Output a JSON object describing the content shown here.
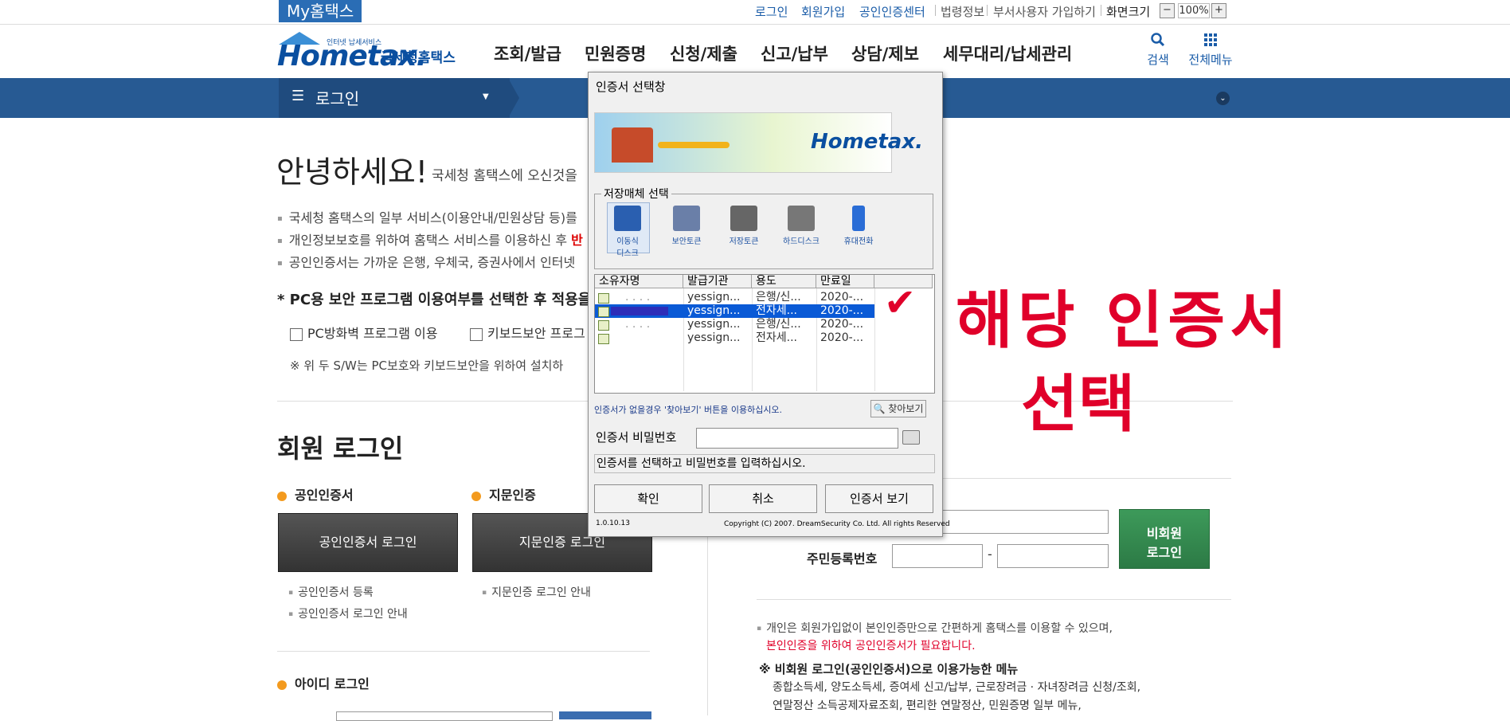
{
  "topbar": {
    "my_hometax": "My홈택스",
    "links": [
      "로그인",
      "회원가입",
      "공인인증센터",
      "법령정보",
      "부서사용자 가입하기",
      "화면크기"
    ],
    "zoom_minus": "−",
    "zoom_value": "100%",
    "zoom_plus": "+"
  },
  "header": {
    "logo_text": "Hometax.",
    "logo_sub": "인터넷 납세서비스",
    "logo_kr": "국세청홈택스",
    "nav": [
      "조회/발급",
      "민원증명",
      "신청/제출",
      "신고/납부",
      "상담/제보",
      "세무대리/납세관리"
    ],
    "search_label": "검색",
    "allmenu_label": "전체메뉴"
  },
  "band": {
    "menu_icon": "☰",
    "menu_label": "로그인",
    "dropdown_icon": "▼",
    "circle_icon": "⌄"
  },
  "main": {
    "greeting": "안녕하세요!",
    "greeting_sub": "국세청 홈택스에 오신것을",
    "bullets": [
      "국세청 홈택스의 일부 서비스(이용안내/민원상담 등)를",
      "개인정보보호를 위하여 홈택스 서비스를 이용하신 후",
      "공인인증서는 가까운 은행, 우체국, 증권사에서 인터넷"
    ],
    "bullet2_red": "반",
    "security_title": "* PC용 보안 프로그램 이용여부를 선택한 후 적용을",
    "cb_firewall": "PC방화벽 프로그램 이용",
    "cb_keyboard": "키보드보안 프로그",
    "sw_note": "※ 위 두 S/W는 PC보호와 키보드보안을 위하여 설치하",
    "member_login": "회원 로그인",
    "cert_section": "공인인증서",
    "finger_section": "지문인증",
    "cert_login_btn": "공인인증서 로그인",
    "finger_login_btn": "지문인증 로그인",
    "cert_links": [
      "공인인증서 등록",
      "공인인증서 로그인 안내"
    ],
    "finger_links": [
      "지문인증 로그인 안내"
    ],
    "id_login": "아이디 로그인",
    "rrn_label": "주민등록번호",
    "rrn_dash": "-",
    "nonmember_btn_line1": "비회원",
    "nonmember_btn_line2": "로그인",
    "nm_bullet": "개인은 회원가입없이 본인인증만으로 간편하게 홈택스를 이용할 수 있으며,",
    "nm_red": "본인인증을 위하여 공인인증서가 필요합니다.",
    "nm_menu_title": "※ 비회원 로그인(공인인증서)으로 이용가능한 메뉴",
    "nm_menu_line1": "종합소득세, 양도소득세, 증여세 신고/납부, 근로장려금 · 자녀장려금 신청/조회,",
    "nm_menu_line2": "연말정산 소득공제자료조회, 편리한 연말정산, 민원증명 일부 메뉴,"
  },
  "dialog": {
    "title": "인증서 선택창",
    "banner_logo": "Hometax.",
    "storage_label": "저장매체 선택",
    "media": [
      {
        "label": "이동식\n디스크",
        "icon": "floppy-disk-icon",
        "color": "#2a5fb0"
      },
      {
        "label": "보안토큰",
        "icon": "security-token-icon",
        "color": "#6a7fa8"
      },
      {
        "label": "저장토큰",
        "icon": "smart-card-icon",
        "color": "#666666"
      },
      {
        "label": "하드디스크",
        "icon": "hard-disk-icon",
        "color": "#777777"
      },
      {
        "label": "휴대전화",
        "icon": "mobile-phone-icon",
        "color": "#2a6dd6"
      }
    ],
    "columns": [
      "소유자명",
      "발급기관",
      "용도",
      "만료일"
    ],
    "rows": [
      {
        "issuer": "yessign...",
        "usage": "은행/신...",
        "expiry": "2020-..."
      },
      {
        "issuer": "yessign...",
        "usage": "전자세...",
        "expiry": "2020-..."
      },
      {
        "issuer": "yessign...",
        "usage": "은행/신...",
        "expiry": "2020-..."
      },
      {
        "issuer": "yessign...",
        "usage": "전자세...",
        "expiry": "2020-..."
      }
    ],
    "owner_partial": ". . . .",
    "hint": "인증서가 없을경우 '찾아보기' 버튼을 이용하십시오.",
    "find_btn": "찾아보기",
    "pw_label": "인증서 비밀번호",
    "status": "인증서를 선택하고 비밀번호를 입력하십시오.",
    "ok_btn": "확인",
    "cancel_btn": "취소",
    "view_btn": "인증서 보기",
    "version": "1.0.10.13",
    "copyright": "Copyright (C) 2007. DreamSecurity Co. Ltd. All rights Reserved"
  },
  "annotation": {
    "check": "✔",
    "line1": "해당 인증서",
    "line2": "선택",
    "color": "#e0002a"
  }
}
